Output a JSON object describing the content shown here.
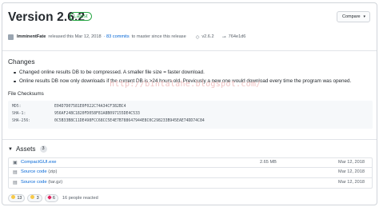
{
  "release": {
    "title": "Version 2.6.2",
    "badge": "Latest",
    "compare_label": "Compare",
    "author": "ImminentFate",
    "released_text": "released this Mar 12, 2018",
    "commits_text": "· 83 commits",
    "commits_suffix": "to master since this release",
    "tag": "v2.6.2",
    "commit": "764e1d6"
  },
  "changes": {
    "heading": "Changes",
    "items": [
      "Changed online results DB to be compressed. A smaller file size = faster download.",
      "Online results DB now only downloads if the current DB is >24 hours old. Previously a new one would download every time the program was opened."
    ]
  },
  "watermark": "http://bintalahe.blogspot.com/",
  "checksums": {
    "heading": "File Checksums",
    "rows": [
      {
        "label": "MD5:",
        "hash": "E04D7D07581E0F022C74A34CF382BC4"
      },
      {
        "label": "SHA-1:",
        "hash": "956AF248C1820FD058F81A8B097155DE4C533"
      },
      {
        "label": "SHA-256:",
        "hash": "0C5B33B8C11DE498FCC68CC5E4E7B788647944E8C0C298233B945EAE74DD74C84"
      }
    ]
  },
  "assets": {
    "heading": "Assets",
    "count": "3",
    "items": [
      {
        "name": "CompactGUI.exe",
        "ext": "",
        "size": "2.65 MB",
        "date": "Mar 12, 2018",
        "icon": "package-icon"
      },
      {
        "name": "Source code",
        "ext": "(zip)",
        "size": "",
        "date": "Mar 12, 2018",
        "icon": "file-zip-icon"
      },
      {
        "name": "Source code",
        "ext": "(tar.gz)",
        "size": "",
        "date": "Mar 12, 2018",
        "icon": "file-zip-icon"
      }
    ]
  },
  "reactions": {
    "items": [
      {
        "emoji": "thumbs-up",
        "count": "13"
      },
      {
        "emoji": "laugh",
        "count": "3"
      },
      {
        "emoji": "heart",
        "count": "6"
      }
    ],
    "summary": "16 people reacted"
  }
}
